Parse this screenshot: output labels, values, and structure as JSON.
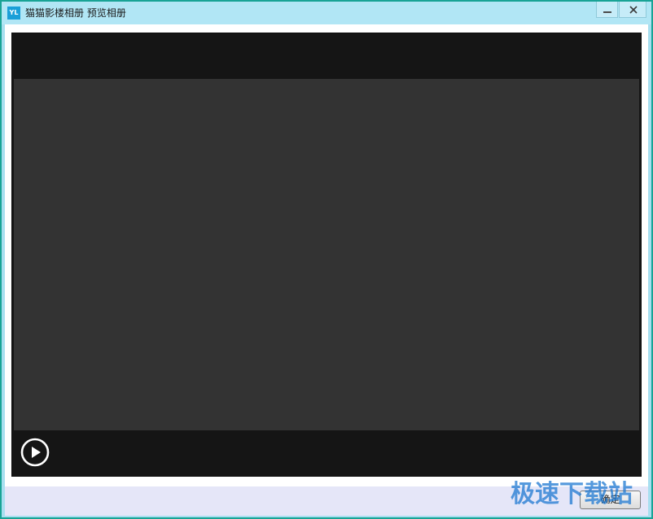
{
  "window": {
    "app_icon_text": "YL",
    "title": "猫猫影楼相册 预览相册"
  },
  "player": {
    "play_icon": "play-circle-icon"
  },
  "footer": {
    "confirm_label": "确定"
  },
  "watermark": {
    "text": "极速下载站"
  },
  "colors": {
    "titlebar": "#b1e6f5",
    "window_border": "#18a395",
    "player_frame": "#151515",
    "video_area": "#333333",
    "footer": "#e5e6f8"
  }
}
